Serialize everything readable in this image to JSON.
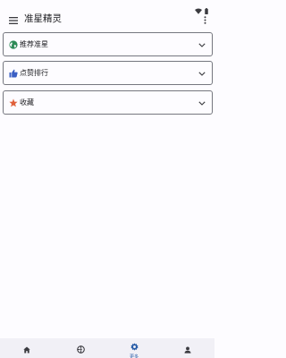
{
  "app": {
    "title": "准星精灵"
  },
  "panels": [
    {
      "label": "推荐准星",
      "icon": "globe-icon",
      "icon_color": "#2e8b57"
    },
    {
      "label": "点赞排行",
      "icon": "thumbs-up-icon",
      "icon_color": "#3b5fc4"
    },
    {
      "label": "收藏",
      "icon": "star-icon",
      "icon_color": "#e0603a"
    }
  ],
  "bottom_nav": {
    "items": [
      {
        "icon": "home-icon",
        "label": ""
      },
      {
        "icon": "crosshair-icon",
        "label": ""
      },
      {
        "icon": "gear-icon",
        "label": "更多",
        "selected": true
      },
      {
        "icon": "person-icon",
        "label": ""
      }
    ]
  },
  "colors": {
    "background": "#fdfcff",
    "border": "#75777f",
    "nav_background": "#f1f0f6",
    "accent": "#2a5ea8",
    "text": "#1b1b1f"
  }
}
